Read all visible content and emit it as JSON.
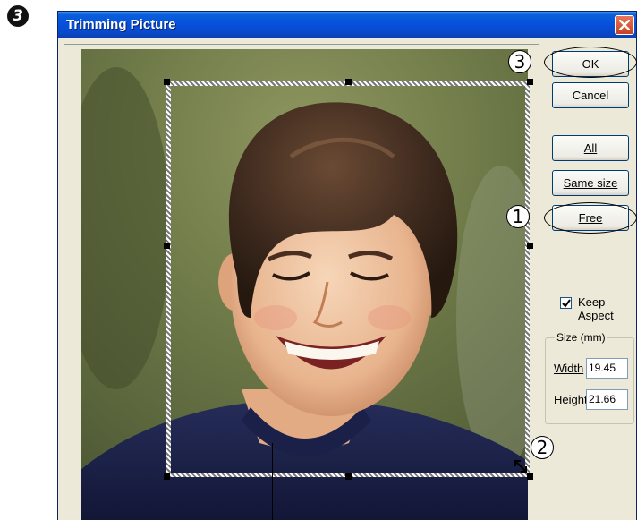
{
  "step_marker": "3",
  "window": {
    "title": "Trimming Picture"
  },
  "buttons": {
    "ok": "OK",
    "cancel": "Cancel",
    "all": "All",
    "same_size": "Same size",
    "free": "Free"
  },
  "keep_aspect": {
    "label": "Keep Aspect",
    "checked": true
  },
  "size_group": {
    "legend": "Size (mm)",
    "width_label": "Width",
    "width_value": "19.45",
    "height_label": "Height",
    "height_value": "21.66"
  },
  "callouts": [
    "1",
    "2",
    "3"
  ],
  "icons": [
    "close-icon",
    "checkmark-icon",
    "resize-arrow-icon"
  ]
}
